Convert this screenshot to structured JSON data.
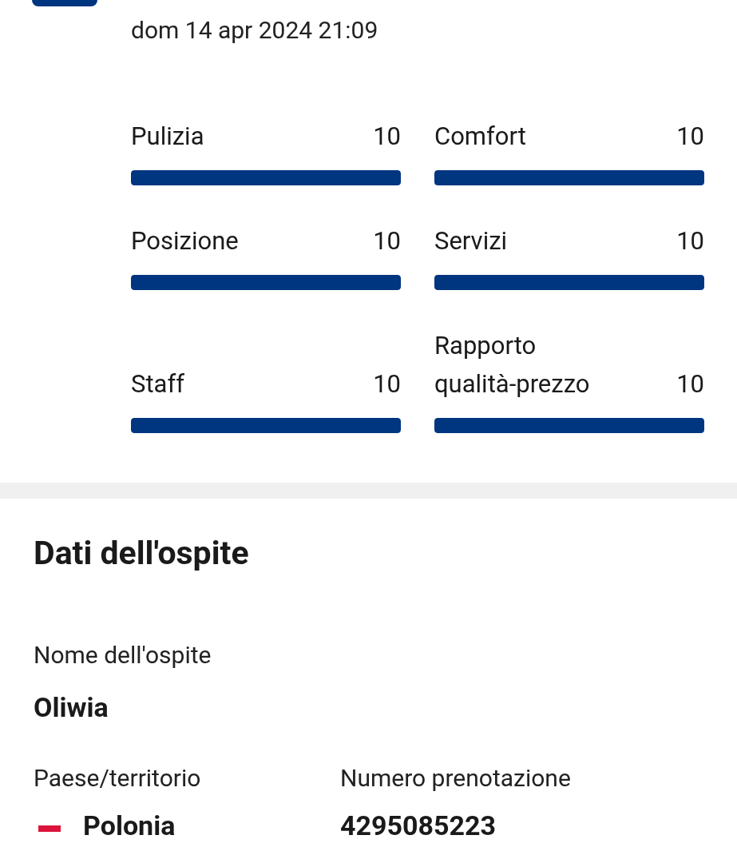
{
  "review": {
    "date": "dom 14 apr 2024 21:09",
    "rating_rows": [
      {
        "ratings": [
          {
            "label": "Pulizia",
            "score": "10",
            "level": 1
          },
          {
            "label": "Comfort",
            "score": "10",
            "level": 1
          }
        ]
      },
      {
        "ratings": [
          {
            "label": "Posizione",
            "score": "10",
            "level": 1
          },
          {
            "label": "Servizi",
            "score": "10",
            "level": 1
          }
        ]
      },
      {
        "ratings": [
          {
            "label": "Staff",
            "score": "10",
            "level": 1
          },
          {
            "label": "Rapporto qualità-prezzo",
            "score": "10",
            "level": 1
          }
        ]
      }
    ]
  },
  "guest": {
    "title": "Dati dell'ospite",
    "fields": [
      {
        "label": "Nome dell'ospite",
        "value": "Oliwia"
      }
    ],
    "country": {
      "label": "Paese/territorio",
      "value": "Polonia"
    },
    "booking": {
      "label": "Numero prenotazione",
      "value": "4295085223"
    }
  }
}
